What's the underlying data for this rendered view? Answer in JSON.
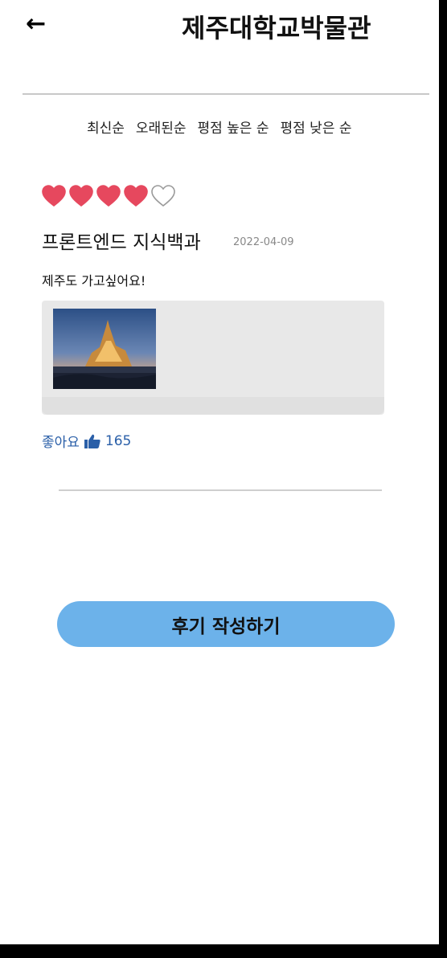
{
  "header": {
    "back_icon": "arrow-left-icon",
    "back_symbol": "←",
    "title": "제주대학교박물관"
  },
  "sort_options": [
    {
      "label": "최신순"
    },
    {
      "label": "오래된순"
    },
    {
      "label": "평점 높은 순"
    },
    {
      "label": "평점 낮은 순"
    }
  ],
  "review": {
    "rating": 4,
    "rating_max": 5,
    "heart_color": "#e6485e",
    "author": "프론트엔드 지식백과",
    "date": "2022-04-09",
    "text": "제주도 가고싶어요!",
    "photo_icon": "castle-photo",
    "likes_label": "좋아요",
    "likes_icon": "thumbs-up-icon",
    "likes_count": "165"
  },
  "write_button": {
    "label": "후기 작성하기",
    "color": "#6cb2ea"
  }
}
